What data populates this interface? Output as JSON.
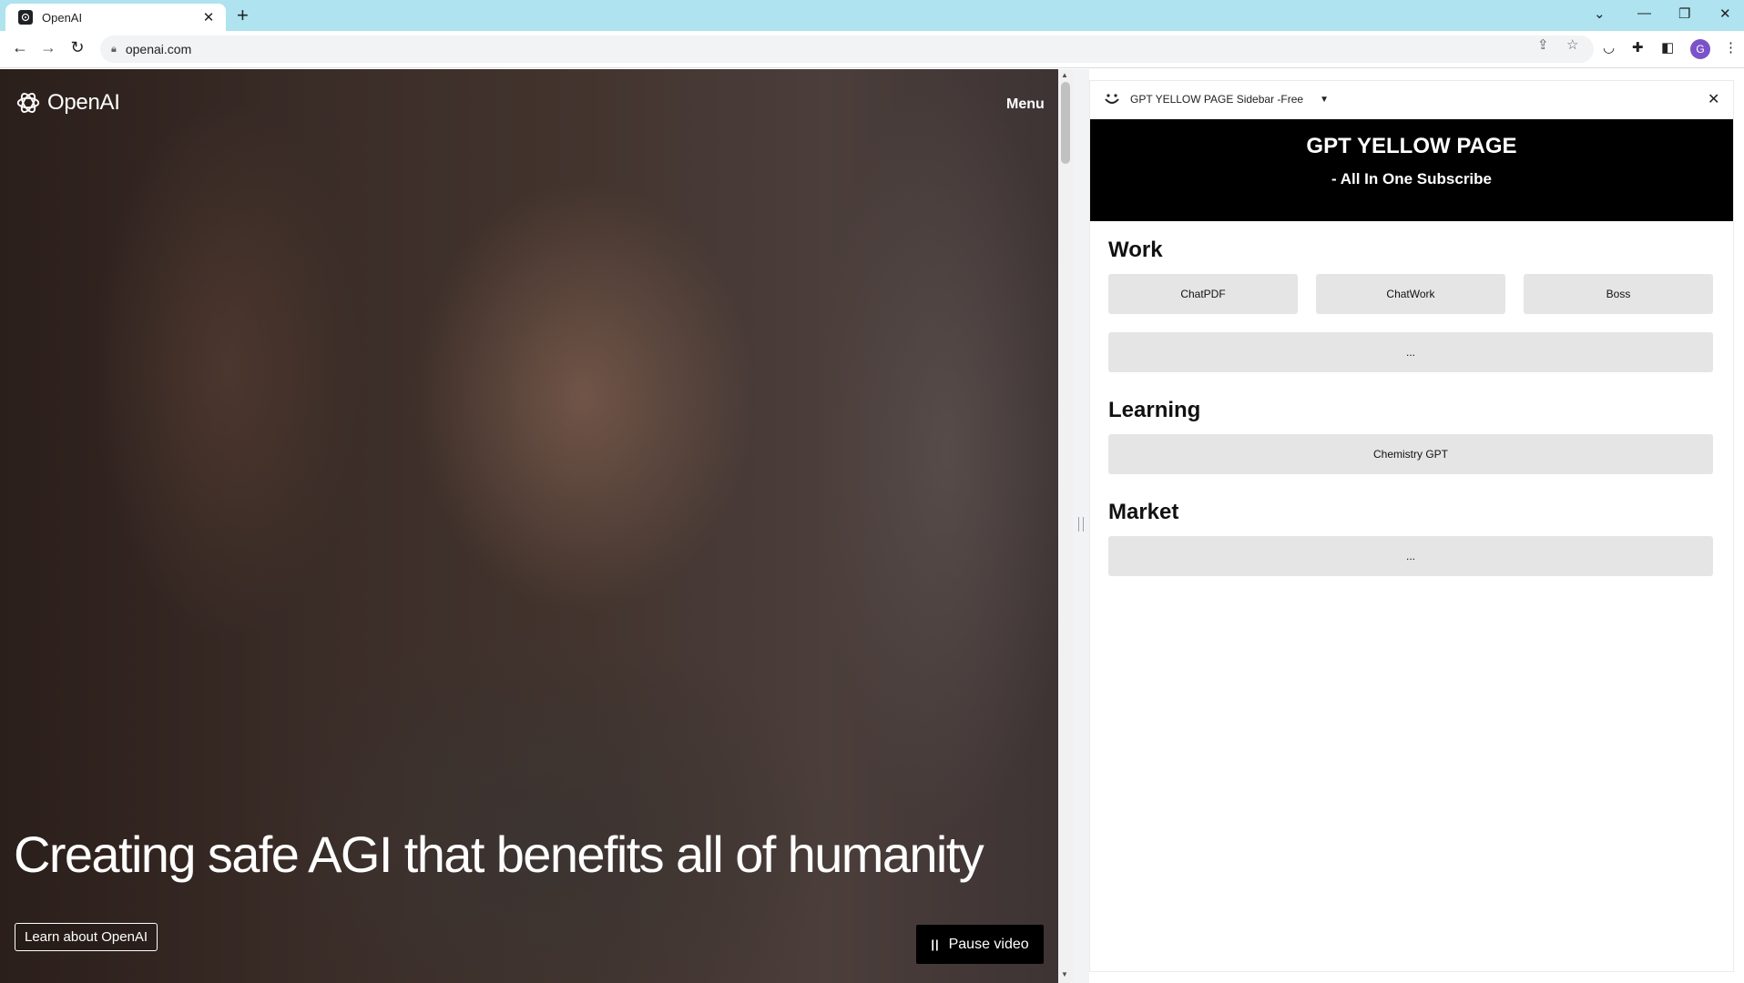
{
  "browser": {
    "tab_title": "OpenAI",
    "new_tab_icon": "plus-icon",
    "url": "openai.com",
    "profile_initial": "G",
    "colors": {
      "tabbar": "#aee3ef",
      "avatar": "#7b52c9"
    }
  },
  "page": {
    "logo_text": "OpenAI",
    "menu_label": "Menu",
    "headline": "Creating safe AGI that benefits all of humanity",
    "learn_button": "Learn about OpenAI",
    "pause_button": "Pause video"
  },
  "sidepanel": {
    "title": "GPT YELLOW PAGE Sidebar -Free",
    "banner_title": "GPT YELLOW PAGE",
    "banner_subtitle": "- All In One Subscribe",
    "sections": [
      {
        "title": "Work",
        "items": [
          "ChatPDF",
          "ChatWork",
          "Boss",
          "..."
        ]
      },
      {
        "title": "Learning",
        "items": [
          "Chemistry GPT"
        ]
      },
      {
        "title": "Market",
        "items": [
          "..."
        ]
      }
    ]
  }
}
